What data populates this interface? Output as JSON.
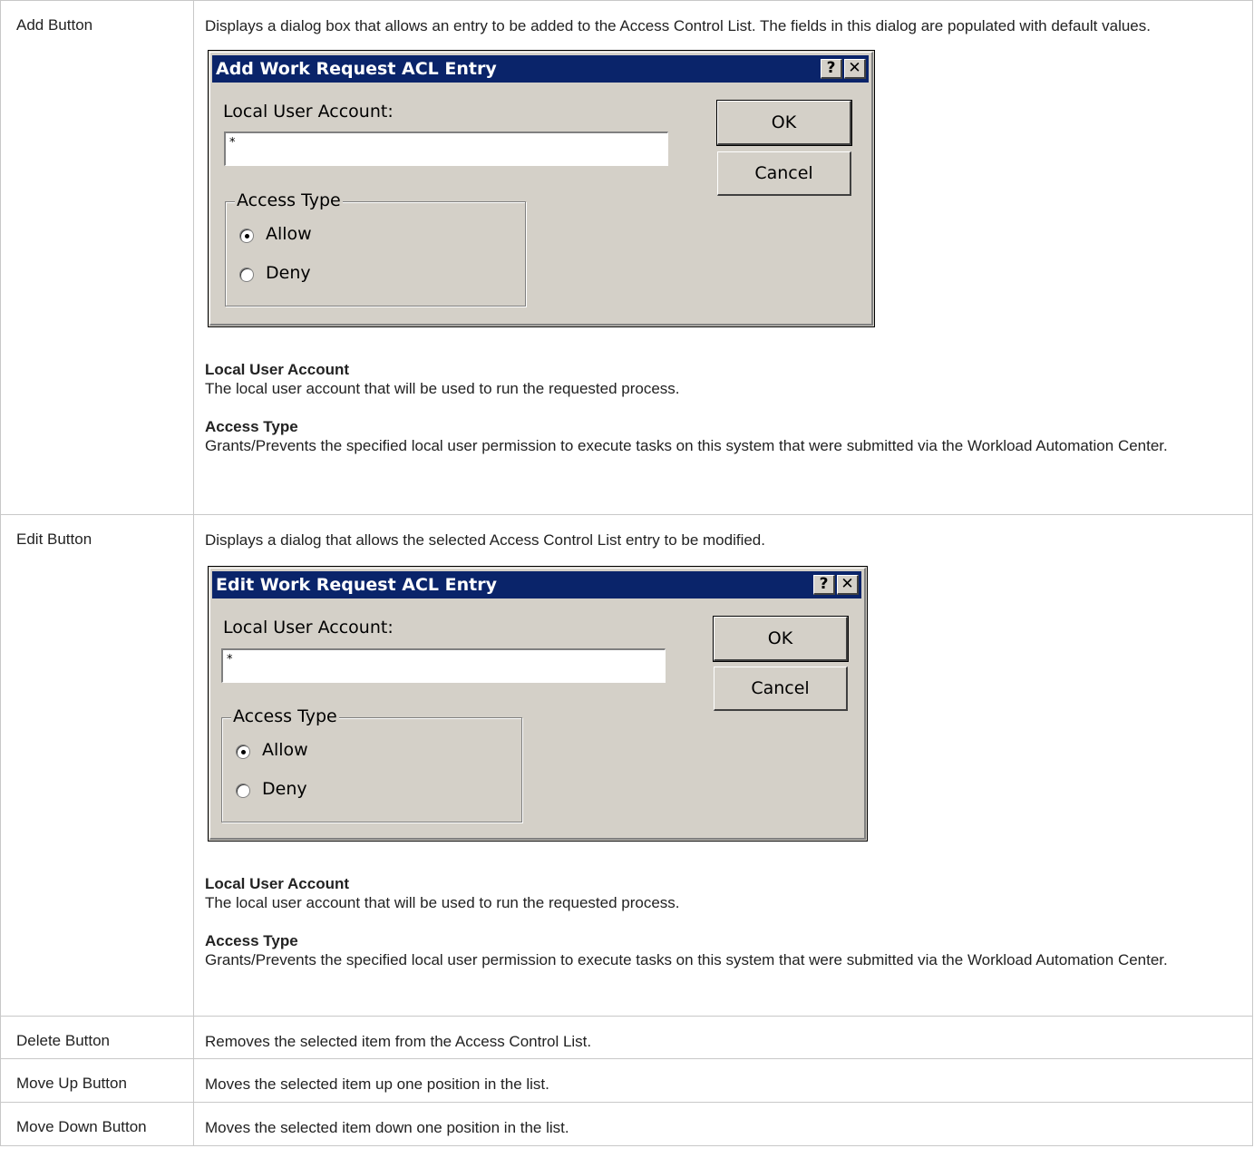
{
  "rows": [
    {
      "name": "Add Button",
      "description": "Displays a dialog box that allows an entry to be added to the Access Control List. The fields in this dialog are populated with default values.",
      "dialog": {
        "title": "Add Work Request ACL Entry",
        "help_button": "?",
        "close_button": "✕",
        "account_label": "Local User Account:",
        "account_value": "*",
        "ok_label": "OK",
        "cancel_label": "Cancel",
        "group_label": "Access Type",
        "allow_label": "Allow",
        "deny_label": "Deny",
        "selected": "Allow"
      },
      "props": [
        {
          "title": "Local User Account",
          "text": "The local user account that will be used to run the requested process."
        },
        {
          "title": "Access Type",
          "text": "Grants/Prevents the specified local user permission to execute tasks on this system that were submitted via the Workload Automation Center."
        }
      ]
    },
    {
      "name": "Edit Button",
      "description": "Displays a dialog that allows the selected Access Control List entry to be modified.",
      "dialog": {
        "title": "Edit Work Request ACL Entry",
        "help_button": "?",
        "close_button": "✕",
        "account_label": "Local User Account:",
        "account_value": "*",
        "ok_label": "OK",
        "cancel_label": "Cancel",
        "group_label": "Access Type",
        "allow_label": "Allow",
        "deny_label": "Deny",
        "selected": "Allow"
      },
      "props": [
        {
          "title": "Local User Account",
          "text": "The local user account that will be used to run the requested process."
        },
        {
          "title": "Access Type",
          "text": "Grants/Prevents the specified local user permission to execute tasks on this system that were submitted via the Workload Automation Center."
        }
      ]
    },
    {
      "name": "Delete Button",
      "description": "Removes the selected item from the Access Control List."
    },
    {
      "name": "Move Up Button",
      "description": "Moves the selected item up one position in the list."
    },
    {
      "name": "Move Down Button",
      "description": "Moves the selected item down one position in the list."
    }
  ]
}
